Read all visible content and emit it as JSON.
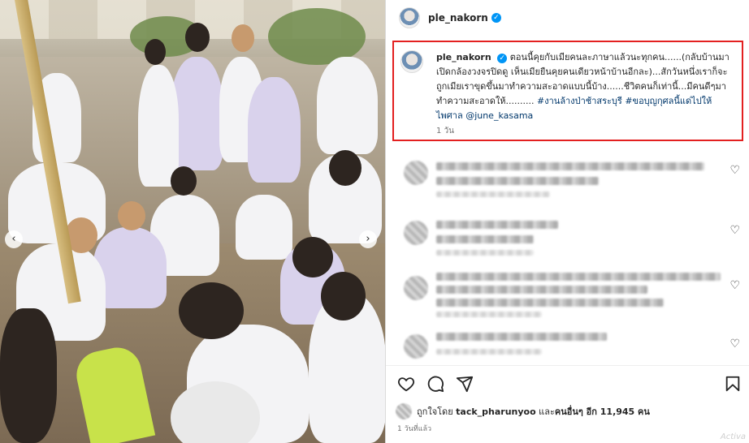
{
  "post": {
    "username": "ple_nakorn",
    "verified_icon": "verified-badge-icon",
    "caption_text": "ตอนนี้คุยกับเมียคนละภาษาแล้วนะทุกคน......(กลับบ้านมาเปิดกล้องวงจรปิดดู เห็นเมียยืนคุยคนเดียวหน้าบ้านอีกละ)...สักวันหนึ่งเราก็จะถูกเมียเราขุดขึ้นมาทำความสะอาดแบบนี้บ้าง......ชีวิตคนก็เท่านี้...มีคนดีๆมาทำความสะอาดให้..........",
    "hashtag_1": "#งานล้างป่าช้าสระบุรี",
    "hashtag_2": "#ขอบุญกุศลนี้แด่ไปให้ไพศาล",
    "mention": "@june_kasama",
    "caption_time": "1 วัน",
    "accent_color": "#e32020",
    "link_color": "#00376b"
  },
  "comments_blurred": 4,
  "footer": {
    "likes_prefix": "ถูกใจโดย",
    "liked_by_user": "tack_pharunyoo",
    "likes_middle": "และ",
    "likes_others": "คนอื่นๆ อีก 11,945 คน",
    "posted_time": "1 วันที่แล้ว",
    "watermark": "Activa"
  },
  "icons": {
    "like": "heart-icon",
    "comment": "comment-icon",
    "share": "share-icon",
    "save": "bookmark-icon",
    "prev": "chevron-left-icon",
    "next": "chevron-right-icon"
  }
}
